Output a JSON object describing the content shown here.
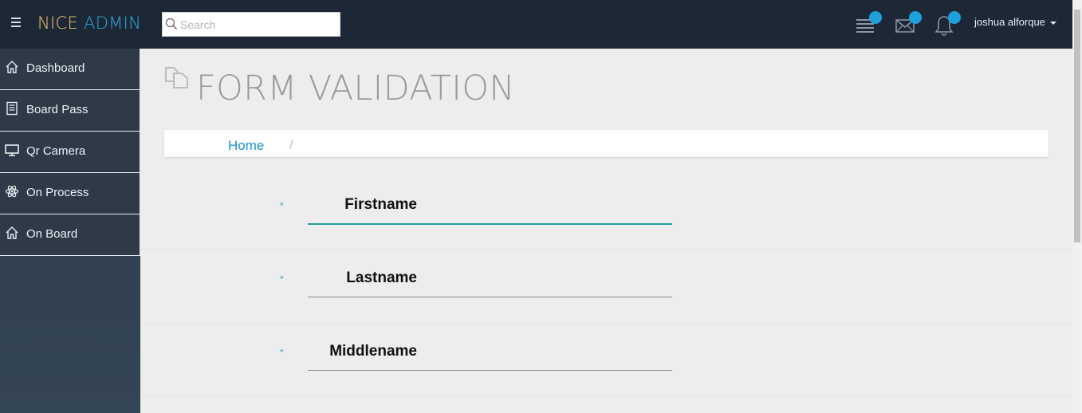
{
  "header": {
    "brand_part1": "NICE",
    "brand_part2": "ADMIN",
    "search_placeholder": "Search",
    "user_name": "joshua alforque",
    "icons": [
      "menu-icon",
      "tasks-icon",
      "mail-icon",
      "bell-icon"
    ],
    "badge_color": "#1ea0dc"
  },
  "sidebar": {
    "items": [
      {
        "label": "Dashboard",
        "icon": "home-icon"
      },
      {
        "label": "Board Pass",
        "icon": "document-icon"
      },
      {
        "label": "Qr Camera",
        "icon": "monitor-icon"
      },
      {
        "label": "On Process",
        "icon": "atom-icon"
      },
      {
        "label": "On Board",
        "icon": "home-icon"
      }
    ]
  },
  "main": {
    "page_title": "FORM VALIDATION",
    "breadcrumb": {
      "home": "Home",
      "separator": "/"
    },
    "form": {
      "required_marker": "*",
      "fields": [
        {
          "label": "Firstname",
          "value": ""
        },
        {
          "label": "Lastname",
          "value": ""
        },
        {
          "label": "Middlename",
          "value": ""
        }
      ]
    }
  },
  "colors": {
    "header_bg": "#1c2836",
    "accent": "#1f9e9e",
    "link": "#1996c8"
  }
}
